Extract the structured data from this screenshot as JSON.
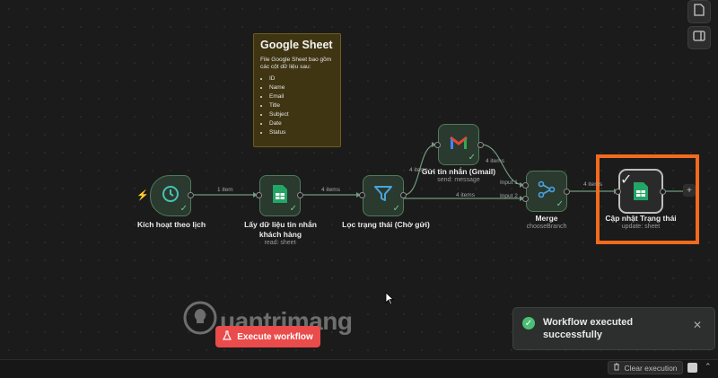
{
  "sticky_note": {
    "title": "Google Sheet",
    "description": "File Google Sheet bao gồm các cột dữ liệu sau:",
    "columns": [
      "ID",
      "Name",
      "Email",
      "Title",
      "Subject",
      "Date",
      "Status"
    ]
  },
  "nodes": {
    "schedule": {
      "label": "Kích hoạt theo lịch",
      "icon": "clock-icon"
    },
    "read_sheet": {
      "label": "Lấy dữ liệu tin nhắn khách hàng",
      "sublabel": "read: sheet",
      "icon": "google-sheets-icon"
    },
    "filter": {
      "label": "Lọc trạng thái (Chờ gửi)",
      "icon": "filter-icon"
    },
    "gmail": {
      "label": "Gửi tin nhắn (Gmail)",
      "sublabel": "send: message",
      "icon": "gmail-icon"
    },
    "merge": {
      "label": "Merge",
      "sublabel": "chooseBranch",
      "icon": "merge-icon"
    },
    "update_sheet": {
      "label": "Cập nhật Trạng thái",
      "sublabel": "update: sheet",
      "icon": "google-sheets-icon"
    }
  },
  "edges": {
    "schedule_to_read": "1 item",
    "read_to_filter": "4 items",
    "filter_to_gmail": "4 items",
    "gmail_out": "4 items",
    "filter_to_merge": "4 items",
    "merge_to_update": "4 items",
    "merge_input1": "Input 1",
    "merge_input2": "Input 2"
  },
  "execute_button": {
    "label": "Execute workflow"
  },
  "toast": {
    "message": "Workflow executed successfully"
  },
  "footer": {
    "clear_label": "Clear execution"
  },
  "watermark": {
    "text": "uantrimang"
  },
  "colors": {
    "accent": "#f26b1d",
    "execute": "#ea4b4b",
    "success": "#4bbf73",
    "node_border": "#4f7a5b"
  }
}
